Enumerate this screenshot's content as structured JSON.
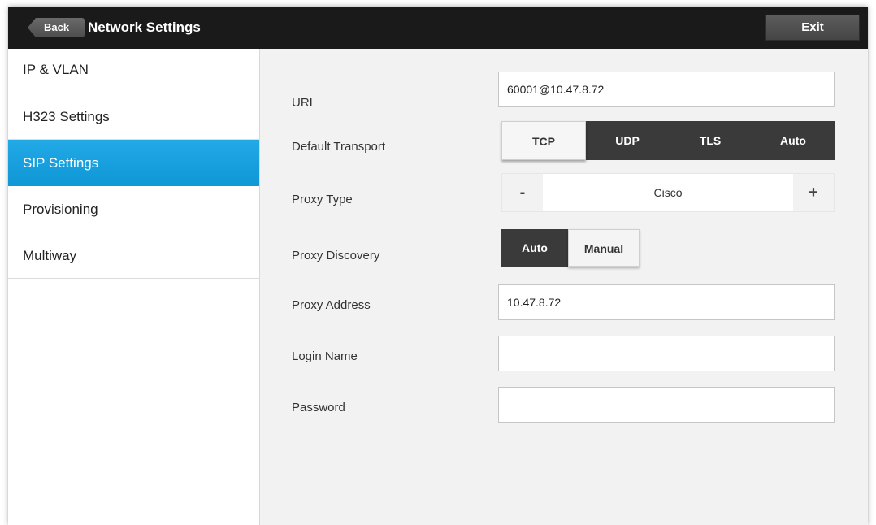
{
  "header": {
    "back_label": "Back",
    "title": "Network Settings",
    "exit_label": "Exit"
  },
  "sidebar": {
    "items": [
      {
        "label": "IP & VLAN",
        "active": false
      },
      {
        "label": "H323 Settings",
        "active": false
      },
      {
        "label": "SIP Settings",
        "active": true
      },
      {
        "label": "Provisioning",
        "active": false
      },
      {
        "label": "Multiway",
        "active": false
      }
    ]
  },
  "form": {
    "uri": {
      "label": "URI",
      "value": "60001@10.47.8.72"
    },
    "default_transport": {
      "label": "Default Transport",
      "options": [
        "TCP",
        "UDP",
        "TLS",
        "Auto"
      ],
      "selected": "TCP"
    },
    "proxy_type": {
      "label": "Proxy Type",
      "minus": "-",
      "value": "Cisco",
      "plus": "+"
    },
    "proxy_discovery": {
      "label": "Proxy Discovery",
      "options": [
        "Auto",
        "Manual"
      ],
      "selected": "Manual"
    },
    "proxy_address": {
      "label": "Proxy Address",
      "value": "10.47.8.72"
    },
    "login_name": {
      "label": "Login Name",
      "value": ""
    },
    "password": {
      "label": "Password",
      "value": ""
    }
  },
  "colors": {
    "accent": "#1aa3e0",
    "topbar": "#1a1a1a",
    "dark_segment": "#3a3a3a"
  }
}
